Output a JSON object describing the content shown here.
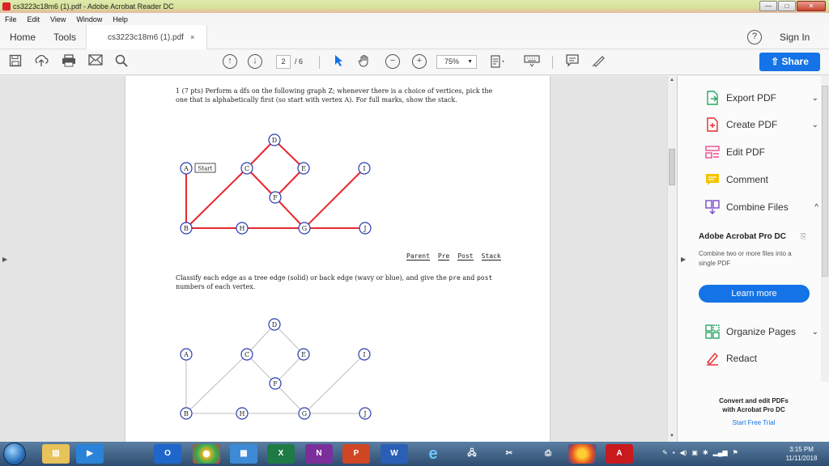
{
  "window": {
    "title": "cs3223c18m6 (1).pdf - Adobe Acrobat Reader DC"
  },
  "menu": [
    "File",
    "Edit",
    "View",
    "Window",
    "Help"
  ],
  "tabs": {
    "home": "Home",
    "tools": "Tools",
    "doc": "cs3223c18m6 (1).pdf",
    "close": "×"
  },
  "header": {
    "help": "?",
    "sign_in": "Sign In"
  },
  "toolbar": {
    "page_current": "2",
    "page_total": "/ 6",
    "zoom": "75%",
    "share": "Share"
  },
  "doc": {
    "q1_line1": "1 (7 pts) Perform a dfs on the following graph Z; whenever there is a choice of vertices, pick the",
    "q1_line2": "one that is alphabetically first (so start with vertex A). For full marks, show the stack.",
    "start_label": "Start",
    "pps_headers": [
      "Parent",
      "Pre",
      "Post",
      "Stack"
    ],
    "q2_line1a": "Classify each edge as a tree edge (solid) or back edge (wavy or blue), and give the ",
    "q2_pre": "pre",
    "q2_and": " and ",
    "q2_post": "post",
    "q2_line2": "numbers of each vertex.",
    "vertices": [
      "A",
      "B",
      "C",
      "D",
      "E",
      "F",
      "G",
      "H",
      "I",
      "J"
    ]
  },
  "right_panel": {
    "tools": [
      {
        "label": "Export PDF",
        "chevron": "⌄"
      },
      {
        "label": "Create PDF",
        "chevron": "⌄"
      },
      {
        "label": "Edit PDF",
        "chevron": ""
      },
      {
        "label": "Comment",
        "chevron": ""
      },
      {
        "label": "Combine Files",
        "chevron": "^"
      }
    ],
    "promo_title": "Adobe Acrobat Pro DC",
    "promo_desc": "Combine two or more files into a single PDF",
    "learn_more": "Learn more",
    "tools2": [
      {
        "label": "Organize Pages",
        "chevron": "⌄"
      },
      {
        "label": "Redact",
        "chevron": ""
      }
    ],
    "footer_line1": "Convert and edit PDFs",
    "footer_line2": "with Acrobat Pro DC",
    "footer_link": "Start Free Trial"
  },
  "taskbar": {
    "time": "3:15 PM",
    "date": "11/11/2018"
  },
  "colors": {
    "accent": "#1473e6",
    "graph_edge_red": "#e8282f",
    "vertex_blue": "#2a3db0"
  }
}
